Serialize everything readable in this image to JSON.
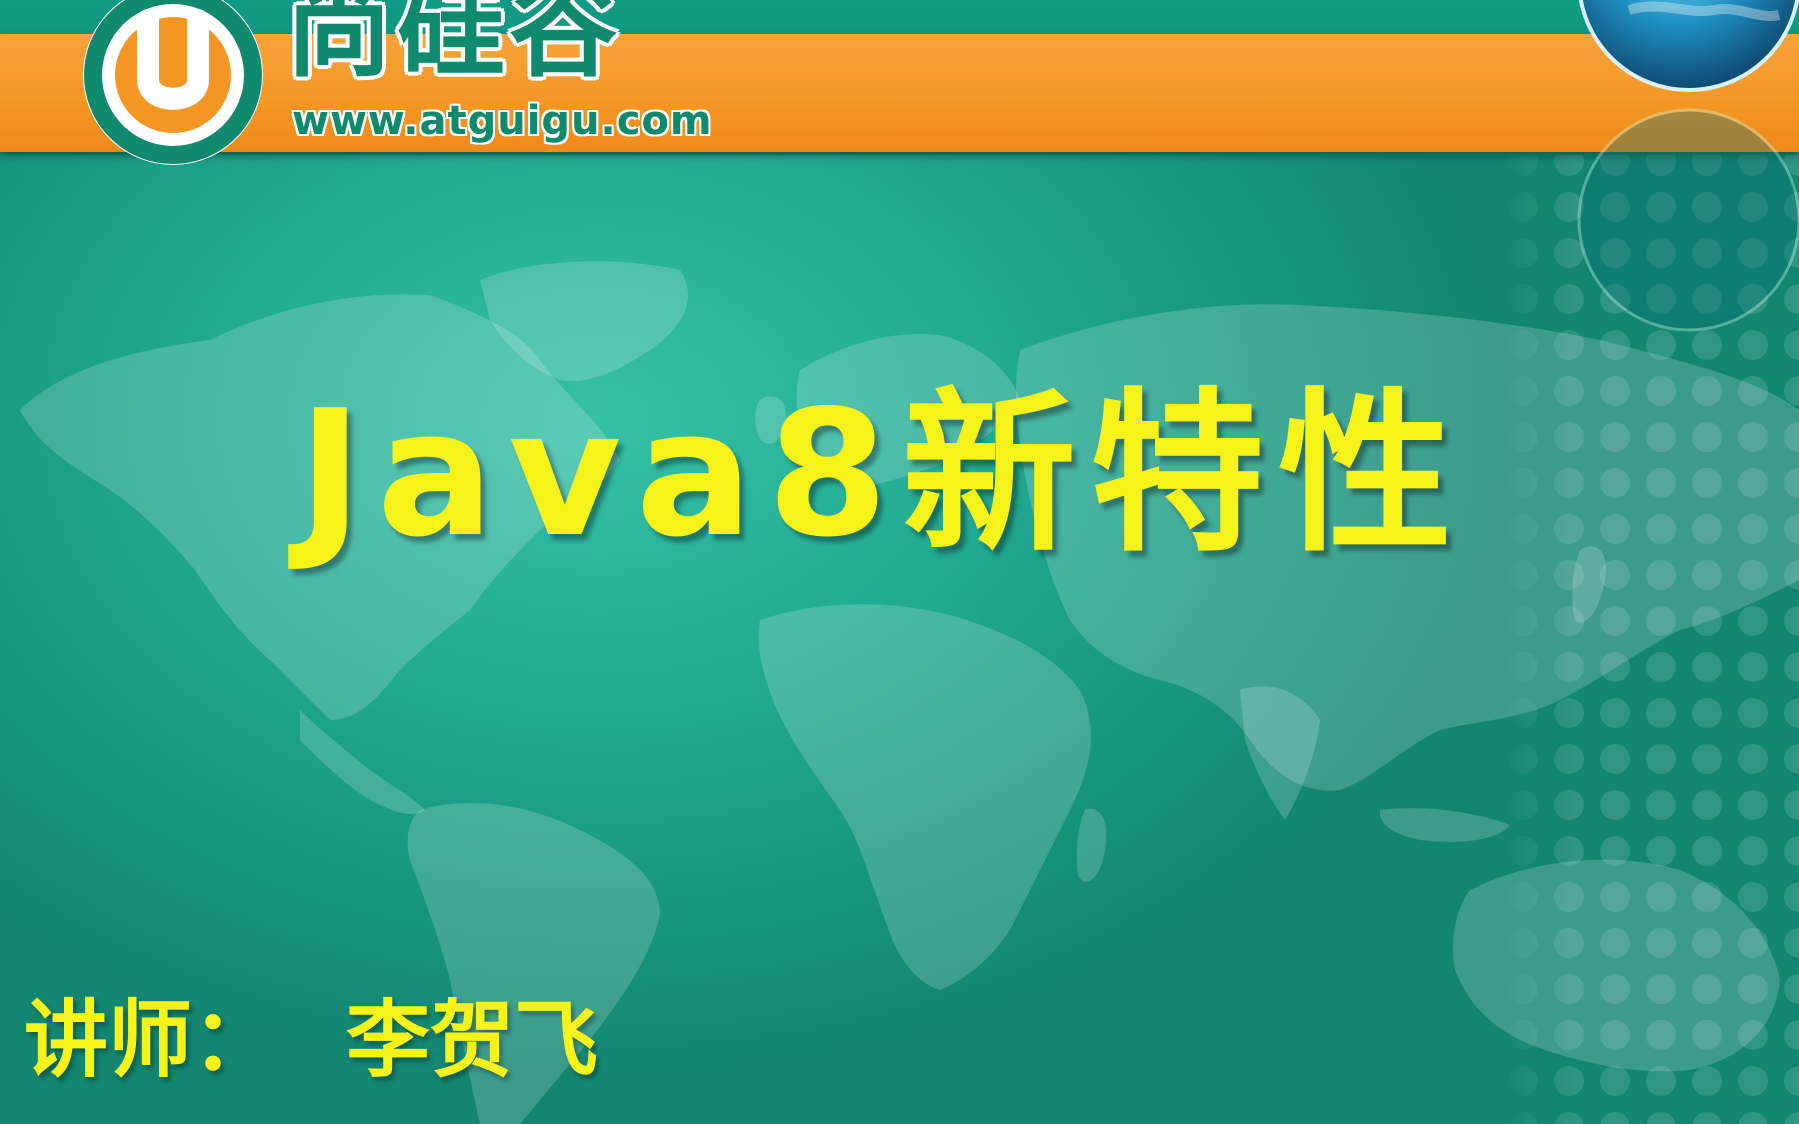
{
  "header": {
    "brand_name": "尚硅谷",
    "brand_url": "www.atguigu.com",
    "logo_letter": "U"
  },
  "slide": {
    "title": "Java8新特性",
    "instructor_label": "讲师：",
    "instructor_name": "李贺飞"
  },
  "colors": {
    "background_teal": "#1aa48d",
    "stripe_orange": "#f39624",
    "title_yellow": "#f6f31a",
    "logo_green": "#0f8a6d"
  }
}
